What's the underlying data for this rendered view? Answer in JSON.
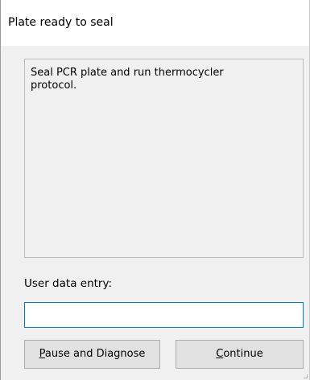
{
  "window": {
    "title": "Plate ready to seal"
  },
  "message": {
    "text": "Seal PCR plate and run thermocycler protocol."
  },
  "entry": {
    "label": "User data entry:",
    "value": ""
  },
  "buttons": {
    "pause": {
      "mnemonic": "P",
      "rest": "ause and Diagnose"
    },
    "continue": {
      "mnemonic": "C",
      "rest": "ontinue"
    }
  },
  "colors": {
    "title_bg": "#ffffff",
    "window_bg": "#f0f0f0",
    "input_focus_border": "#0078d7",
    "button_bg": "#e1e1e1",
    "button_border": "#adadad"
  }
}
